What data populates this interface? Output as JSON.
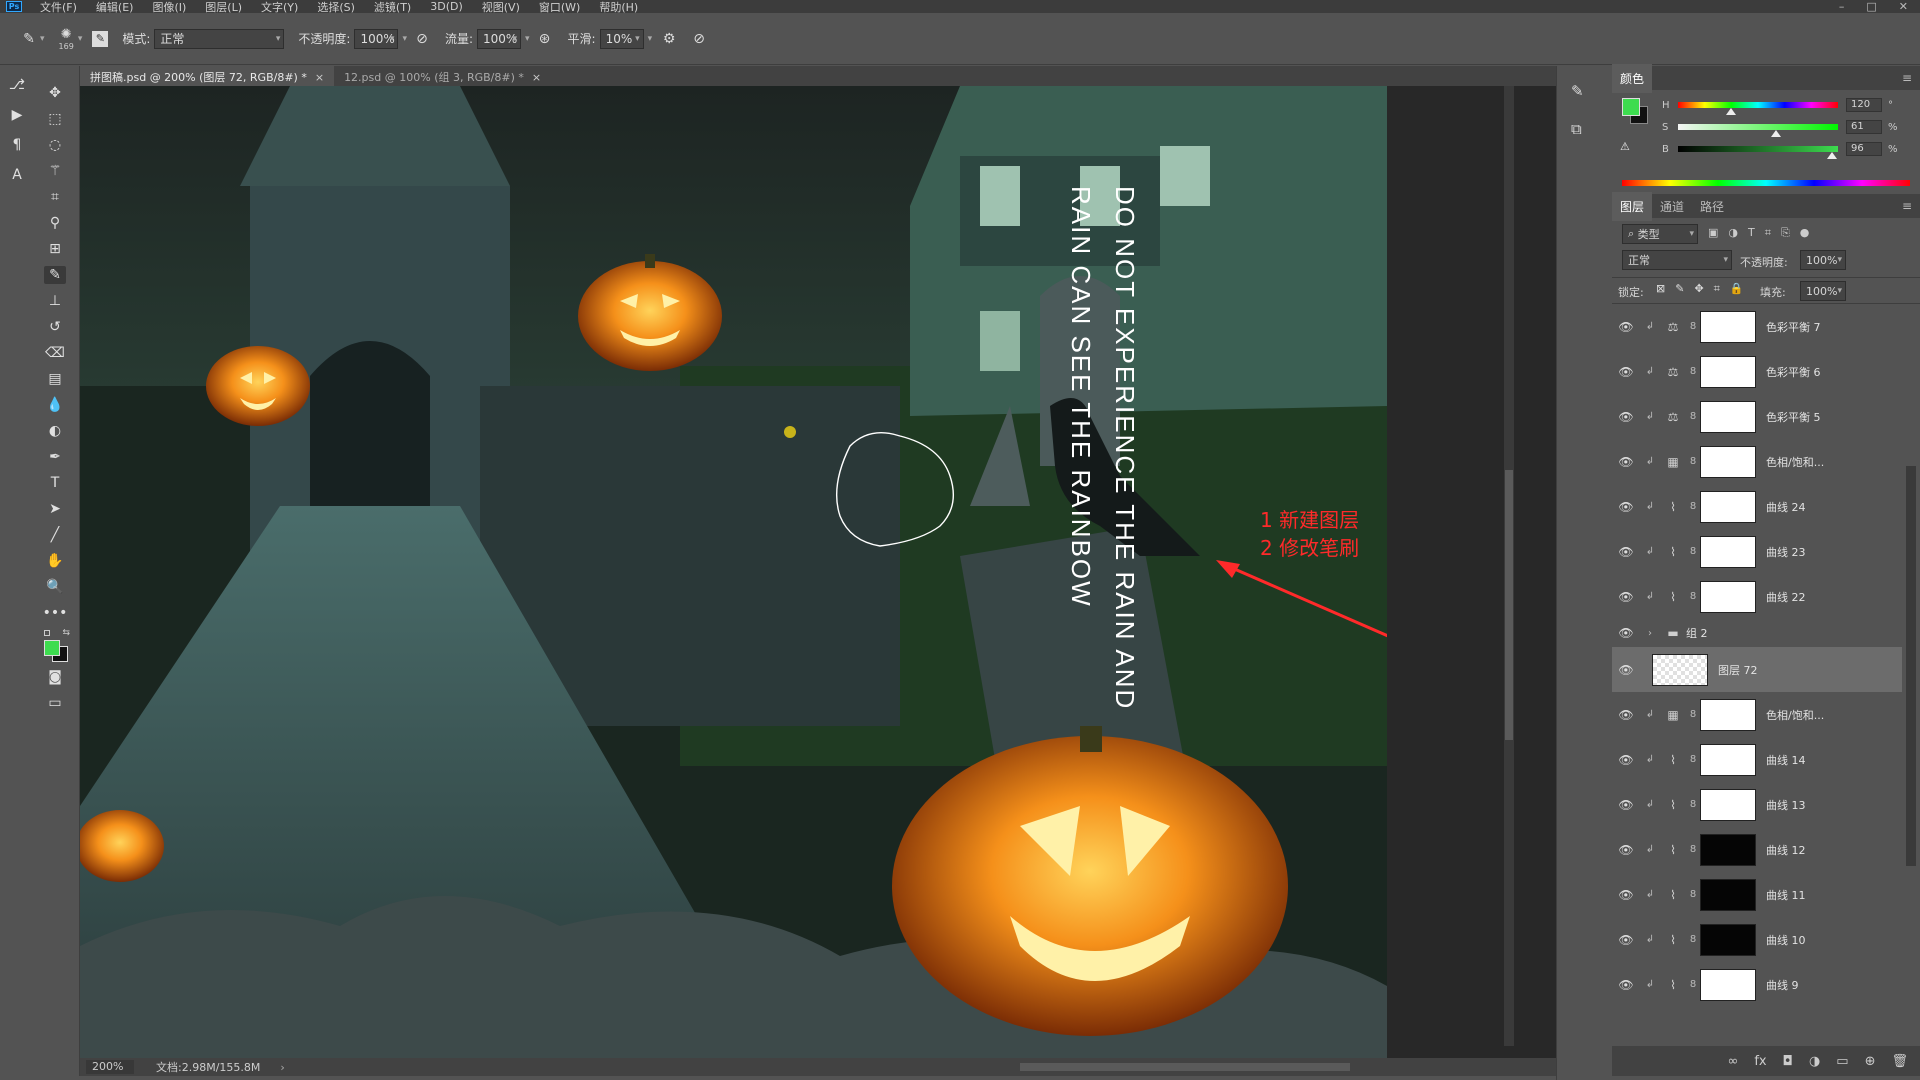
{
  "menu": {
    "items": [
      "文件(F)",
      "编辑(E)",
      "图像(I)",
      "图层(L)",
      "文字(Y)",
      "选择(S)",
      "滤镜(T)",
      "3D(D)",
      "视图(V)",
      "窗口(W)",
      "帮助(H)"
    ],
    "logo": "Ps"
  },
  "window": {
    "minimize": "–",
    "restore": "□",
    "close": "✕"
  },
  "options": {
    "brush_size": "169",
    "mode_label": "模式:",
    "mode_value": "正常",
    "opacity_label": "不透明度:",
    "opacity_value": "100%",
    "flow_label": "流量:",
    "flow_value": "100%",
    "smooth_label": "平滑:",
    "smooth_value": "10%"
  },
  "tabs": [
    {
      "label": "拼图稿.psd @ 200% (图层 72, RGB/8#) *",
      "active": true
    },
    {
      "label": "12.psd @ 100% (组 3, RGB/8#) *",
      "active": false
    }
  ],
  "canvas": {
    "text_line1": "DO NOT EXPERIENCE THE RAIN AND",
    "text_line2": "RAIN CAN SEE THE RAINBOW",
    "annotation_1": "1 新建图层",
    "annotation_2": "2 修改笔刷",
    "annotation_color": "#ff2a2a"
  },
  "status": {
    "zoom": "200%",
    "doc": "文档:2.98M/155.8M"
  },
  "color_panel": {
    "tab": "颜色",
    "h_label": "H",
    "h_value": "120",
    "h_unit": "°",
    "h_level": 0.33,
    "s_label": "S",
    "s_value": "61",
    "s_unit": "%",
    "s_level": 0.61,
    "b_label": "B",
    "b_value": "96",
    "b_unit": "%",
    "b_level": 0.96,
    "foreground": "#3ddc4f",
    "background": "#111111"
  },
  "layers_panel": {
    "tabs": [
      "图层",
      "通道",
      "路径"
    ],
    "filter_label": "类型",
    "blend_mode": "正常",
    "opacity_label": "不透明度:",
    "opacity_value": "100%",
    "lock_label": "锁定:",
    "fill_label": "填充:",
    "fill_value": "100%",
    "layers": [
      {
        "name": "色彩平衡 7",
        "type": "balance",
        "thumb": "white"
      },
      {
        "name": "色彩平衡 6",
        "type": "balance",
        "thumb": "white"
      },
      {
        "name": "色彩平衡 5",
        "type": "balance",
        "thumb": "white"
      },
      {
        "name": "色相/饱和...",
        "type": "hue",
        "thumb": "white"
      },
      {
        "name": "曲线 24",
        "type": "curve",
        "thumb": "white"
      },
      {
        "name": "曲线 23",
        "type": "curve",
        "thumb": "white"
      },
      {
        "name": "曲线 22",
        "type": "curve",
        "thumb": "white"
      },
      {
        "name": "组 2",
        "type": "group",
        "thumb": "none"
      },
      {
        "name": "图层 72",
        "type": "pixel",
        "thumb": "check",
        "selected": true
      },
      {
        "name": "色相/饱和...",
        "type": "hue",
        "thumb": "white"
      },
      {
        "name": "曲线 14",
        "type": "curve",
        "thumb": "white"
      },
      {
        "name": "曲线 13",
        "type": "curve",
        "thumb": "white"
      },
      {
        "name": "曲线 12",
        "type": "curve",
        "thumb": "dark"
      },
      {
        "name": "曲线 11",
        "type": "curve",
        "thumb": "dark"
      },
      {
        "name": "曲线 10",
        "type": "curve",
        "thumb": "dark"
      },
      {
        "name": "曲线 9",
        "type": "curve",
        "thumb": "white"
      }
    ]
  }
}
